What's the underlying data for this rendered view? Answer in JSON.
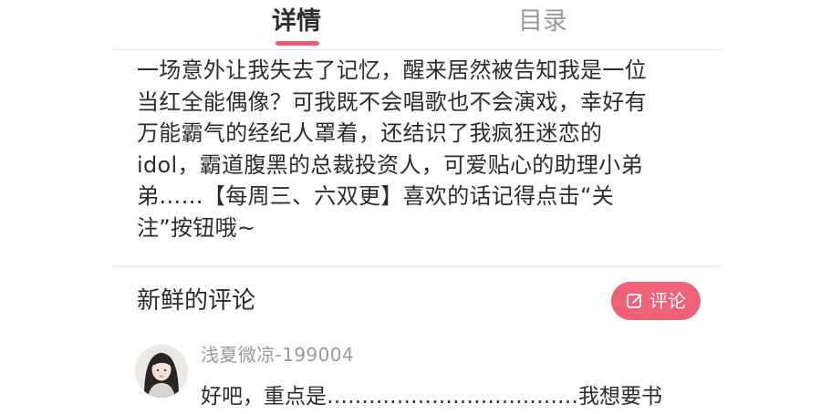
{
  "tabs": {
    "detail": "详情",
    "catalog": "目录"
  },
  "description": {
    "lines": [
      "一场意外让我失去了记忆，醒来居然被告知我是一位",
      "当红全能偶像？可我既不会唱歌也不会演戏，幸好有",
      "万能霸气的经纪人罩着，还结识了我疯狂迷恋的",
      "idol，霸道腹黑的总裁投资人，可爱贴心的助理小弟",
      "弟……【每周三、六双更】喜欢的话记得点击“关",
      "注”按钮哦~"
    ]
  },
  "comments": {
    "title": "新鲜的评论",
    "button_label": "评论",
    "items": [
      {
        "user": "浅夏微凉-199004",
        "text": "好吧，重点是………………………………我想要书"
      }
    ]
  },
  "colors": {
    "accent": "#f05a78",
    "button": "#ef6177",
    "muted_text": "#9a9a9a"
  },
  "icons": {
    "comment_button": "edit-icon",
    "avatar": "user-avatar"
  }
}
